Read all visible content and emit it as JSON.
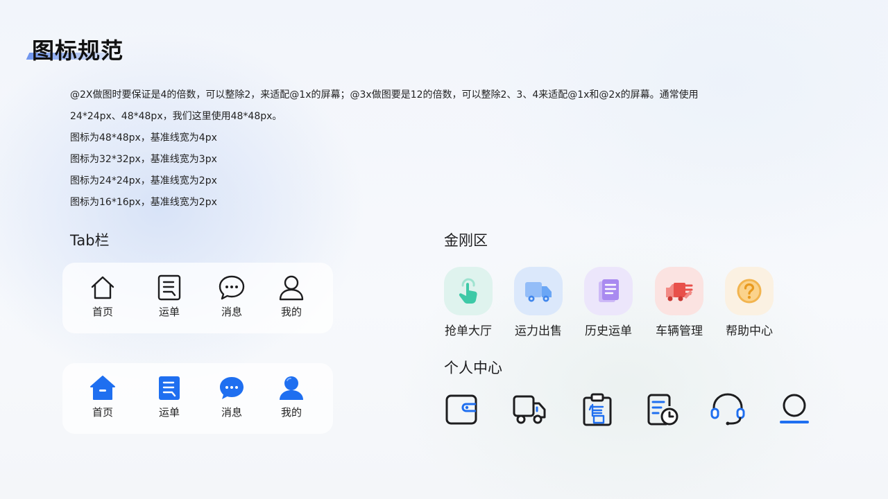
{
  "page": {
    "title": "图标规范"
  },
  "description": [
    "@2X做图时要保证是4的倍数，可以整除2，来适配@1x的屏幕；@3x做图要是12的倍数，可以整除2、3、4来适配@1x和@2x的屏幕。通常使用",
    "24*24px、48*48px，我们这里使用48*48px。",
    "图标为48*48px，基准线宽为4px",
    "图标为32*32px，基准线宽为3px",
    "图标为24*24px，基准线宽为2px",
    "图标为16*16px，基准线宽为2px"
  ],
  "tab_section": {
    "label": "Tab栏",
    "outline_tabs": [
      {
        "label": "首页",
        "icon": "home-icon"
      },
      {
        "label": "运单",
        "icon": "waybill-icon"
      },
      {
        "label": "消息",
        "icon": "message-icon"
      },
      {
        "label": "我的",
        "icon": "user-icon"
      }
    ],
    "filled_tabs": [
      {
        "label": "首页",
        "icon": "home-icon"
      },
      {
        "label": "运单",
        "icon": "waybill-icon"
      },
      {
        "label": "消息",
        "icon": "message-icon"
      },
      {
        "label": "我的",
        "icon": "user-icon"
      }
    ]
  },
  "kingkong_section": {
    "label": "金刚区",
    "items": [
      {
        "label": "抢单大厅",
        "icon": "tap-hand-icon",
        "bg": "#dff3ee",
        "color": "#3ec9a7"
      },
      {
        "label": "运力出售",
        "icon": "truck-icon",
        "bg": "#dbe8fb",
        "color": "#6aa6f5"
      },
      {
        "label": "历史运单",
        "icon": "document-stack-icon",
        "bg": "#ece6fb",
        "color": "#a98af0"
      },
      {
        "label": "车辆管理",
        "icon": "fast-truck-icon",
        "bg": "#fbe3e1",
        "color": "#e8504a"
      },
      {
        "label": "帮助中心",
        "icon": "question-icon",
        "bg": "#fbf1e2",
        "color": "#f2b44e"
      }
    ]
  },
  "personal_section": {
    "label": "个人中心",
    "icons": [
      "wallet-icon",
      "truck-icon",
      "sale-clipboard-icon",
      "history-doc-icon",
      "headset-icon",
      "profile-icon"
    ]
  },
  "colors": {
    "accent": "#1f6ff0",
    "outline": "#1d1d1f"
  }
}
